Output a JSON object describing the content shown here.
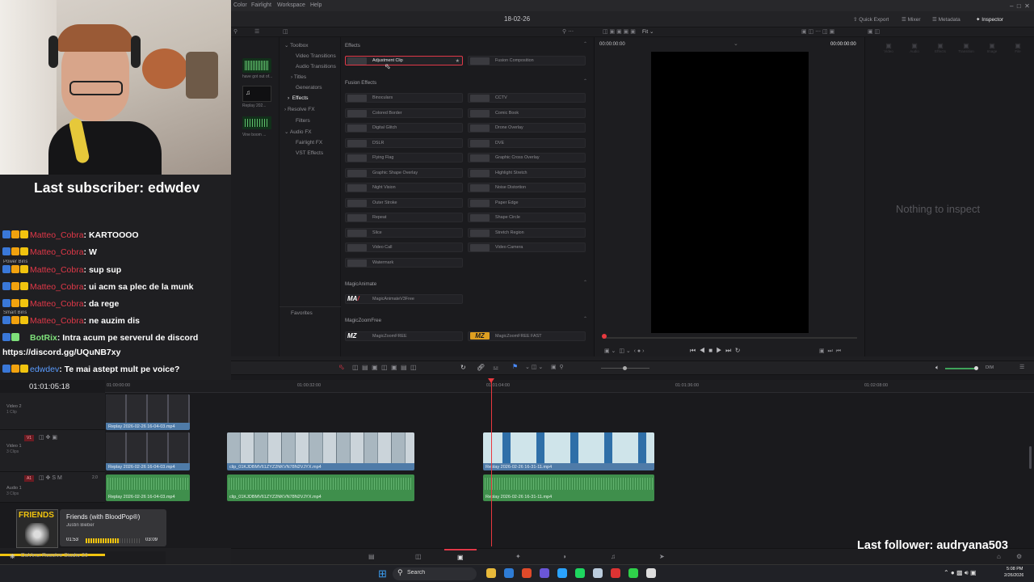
{
  "menubar": {
    "items": [
      "Color",
      "Fairlight",
      "Workspace",
      "Help"
    ],
    "project_title": "18-02-26"
  },
  "header_buttons": {
    "quick_export": "Quick Export",
    "mixer": "Mixer",
    "metadata": "Metadata",
    "inspector": "Inspector"
  },
  "library": {
    "items": [
      {
        "label": "Replay 202..."
      },
      {
        "label": "Vine boom ..."
      },
      {
        "label": "Power Bins"
      },
      {
        "label": "Smart Bins"
      }
    ],
    "audio_clip": "have got out of..."
  },
  "tree": {
    "items": [
      "Toolbox",
      "Video Transitions",
      "Audio Transitions",
      "Titles",
      "Generators",
      "Effects",
      "Resolve FX",
      "Filters",
      "Audio FX",
      "Fairlight FX",
      "VST Effects"
    ],
    "favorites": "Favorites"
  },
  "effects_panel": {
    "section_effects": "Effects",
    "adjustment_clip": "Adjustment Clip",
    "fusion_composition": "Fusion Composition",
    "section_fusion": "Fusion Effects",
    "fusion_left": [
      "Binoculars",
      "Colored Border",
      "Digital Glitch",
      "DSLR",
      "Flying Flag",
      "Graphic Shape Overlay",
      "Night Vision",
      "Outer Stroke",
      "Repeat",
      "Slice",
      "Video Call",
      "Watermark"
    ],
    "fusion_right": [
      "CCTV",
      "Comic Book",
      "Drone Overlay",
      "DVE",
      "Graphic Cross Overlay",
      "Highlight Stretch",
      "Noise Distortion",
      "Paper Edge",
      "Shape Circle",
      "Stretch Region",
      "Video Camera"
    ],
    "section_magicanimate": "MagicAnimate",
    "magicanimate_item": "MagicAnimateV3Free",
    "section_magiczoom": "MagicZoomFree",
    "magiczoom_items": [
      "MagicZoomFREE",
      "MagicZoomFREE FAST"
    ]
  },
  "viewer": {
    "timecode_left": "00:00:00:00",
    "zoom": "Fit",
    "timecode_right": "00:00:00:00"
  },
  "inspector": {
    "empty_text": "Nothing to inspect",
    "tabs": [
      "Video",
      "Audio",
      "Effects",
      "Transition",
      "Image",
      "File"
    ]
  },
  "timeline": {
    "timecode": "01:01:05:18",
    "ruler": [
      "01:00:00:00",
      "01:00:32:00",
      "01:01:04:00",
      "01:01:36:00",
      "01:02:08:00"
    ],
    "tracks": [
      {
        "id": "V2",
        "name": "Video 2",
        "count": "1 Clip"
      },
      {
        "id": "V1",
        "name": "Video 1",
        "count": "3 Clips"
      },
      {
        "id": "A1",
        "name": "Audio 1",
        "count": "3 Clips",
        "level": "2.0"
      }
    ],
    "clips": {
      "v2_clip": "Replay 2026-02-26 16-04-03.mp4",
      "v1_clip1": "Replay 2026-02-26 16-04-03.mp4",
      "v1_clip2": "clip_01KJDBMV61ZYZ2NKVN78N2VJYX.mp4",
      "v1_clip3": "Replay 2026-02-26 16-31-11.mp4",
      "a1_clip1": "Replay 2026-02-26 16-04-03.mp4",
      "a1_clip2": "clip_01KJDBMV61ZYZ2NKVN78N2VJYX.mp4",
      "a1_clip3": "Replay 2026-02-26 16-31-11.mp4"
    },
    "dim_label": "DIM"
  },
  "overlay": {
    "last_subscriber": "Last subscriber: edwdev",
    "last_follower": "Last follower: audryana503",
    "chat": [
      {
        "user": "Matteo_Cobra",
        "msg": ": KARTOOOO"
      },
      {
        "user": "Matteo_Cobra",
        "msg": ": W"
      },
      {
        "user": "Matteo_Cobra",
        "msg": ": sup sup"
      },
      {
        "user": "Matteo_Cobra",
        "msg": ": ui acm sa plec de la munk"
      },
      {
        "user": "Matteo_Cobra",
        "msg": ": da rege"
      },
      {
        "user": "Matteo_Cobra",
        "msg": ": ne auzim dis"
      },
      {
        "user": "BotRix",
        "msg": ": Intra acum pe serverul de discord"
      },
      {
        "user": "",
        "msg": "https://discord.gg/UQuNB7xy"
      },
      {
        "user": "edwdev",
        "msg": ": Te mai astept mult pe voice?"
      }
    ],
    "music": {
      "title": "Friends (with BloodPop®)",
      "artist": "Justin Bieber",
      "elapsed": "01:53",
      "total": "03:09",
      "progress": 0.6,
      "cover_text": "FRIENDS"
    },
    "app_name": "DaVinci Resolve Studio 20"
  },
  "taskbar": {
    "search": "Search",
    "time": "5:08 PM",
    "date": "2/26/2026"
  },
  "colors": {
    "accent_red": "#e03848",
    "clip_blue": "#4f7ba8",
    "clip_green": "#3f8f4c",
    "playhead": "#e8393f"
  }
}
